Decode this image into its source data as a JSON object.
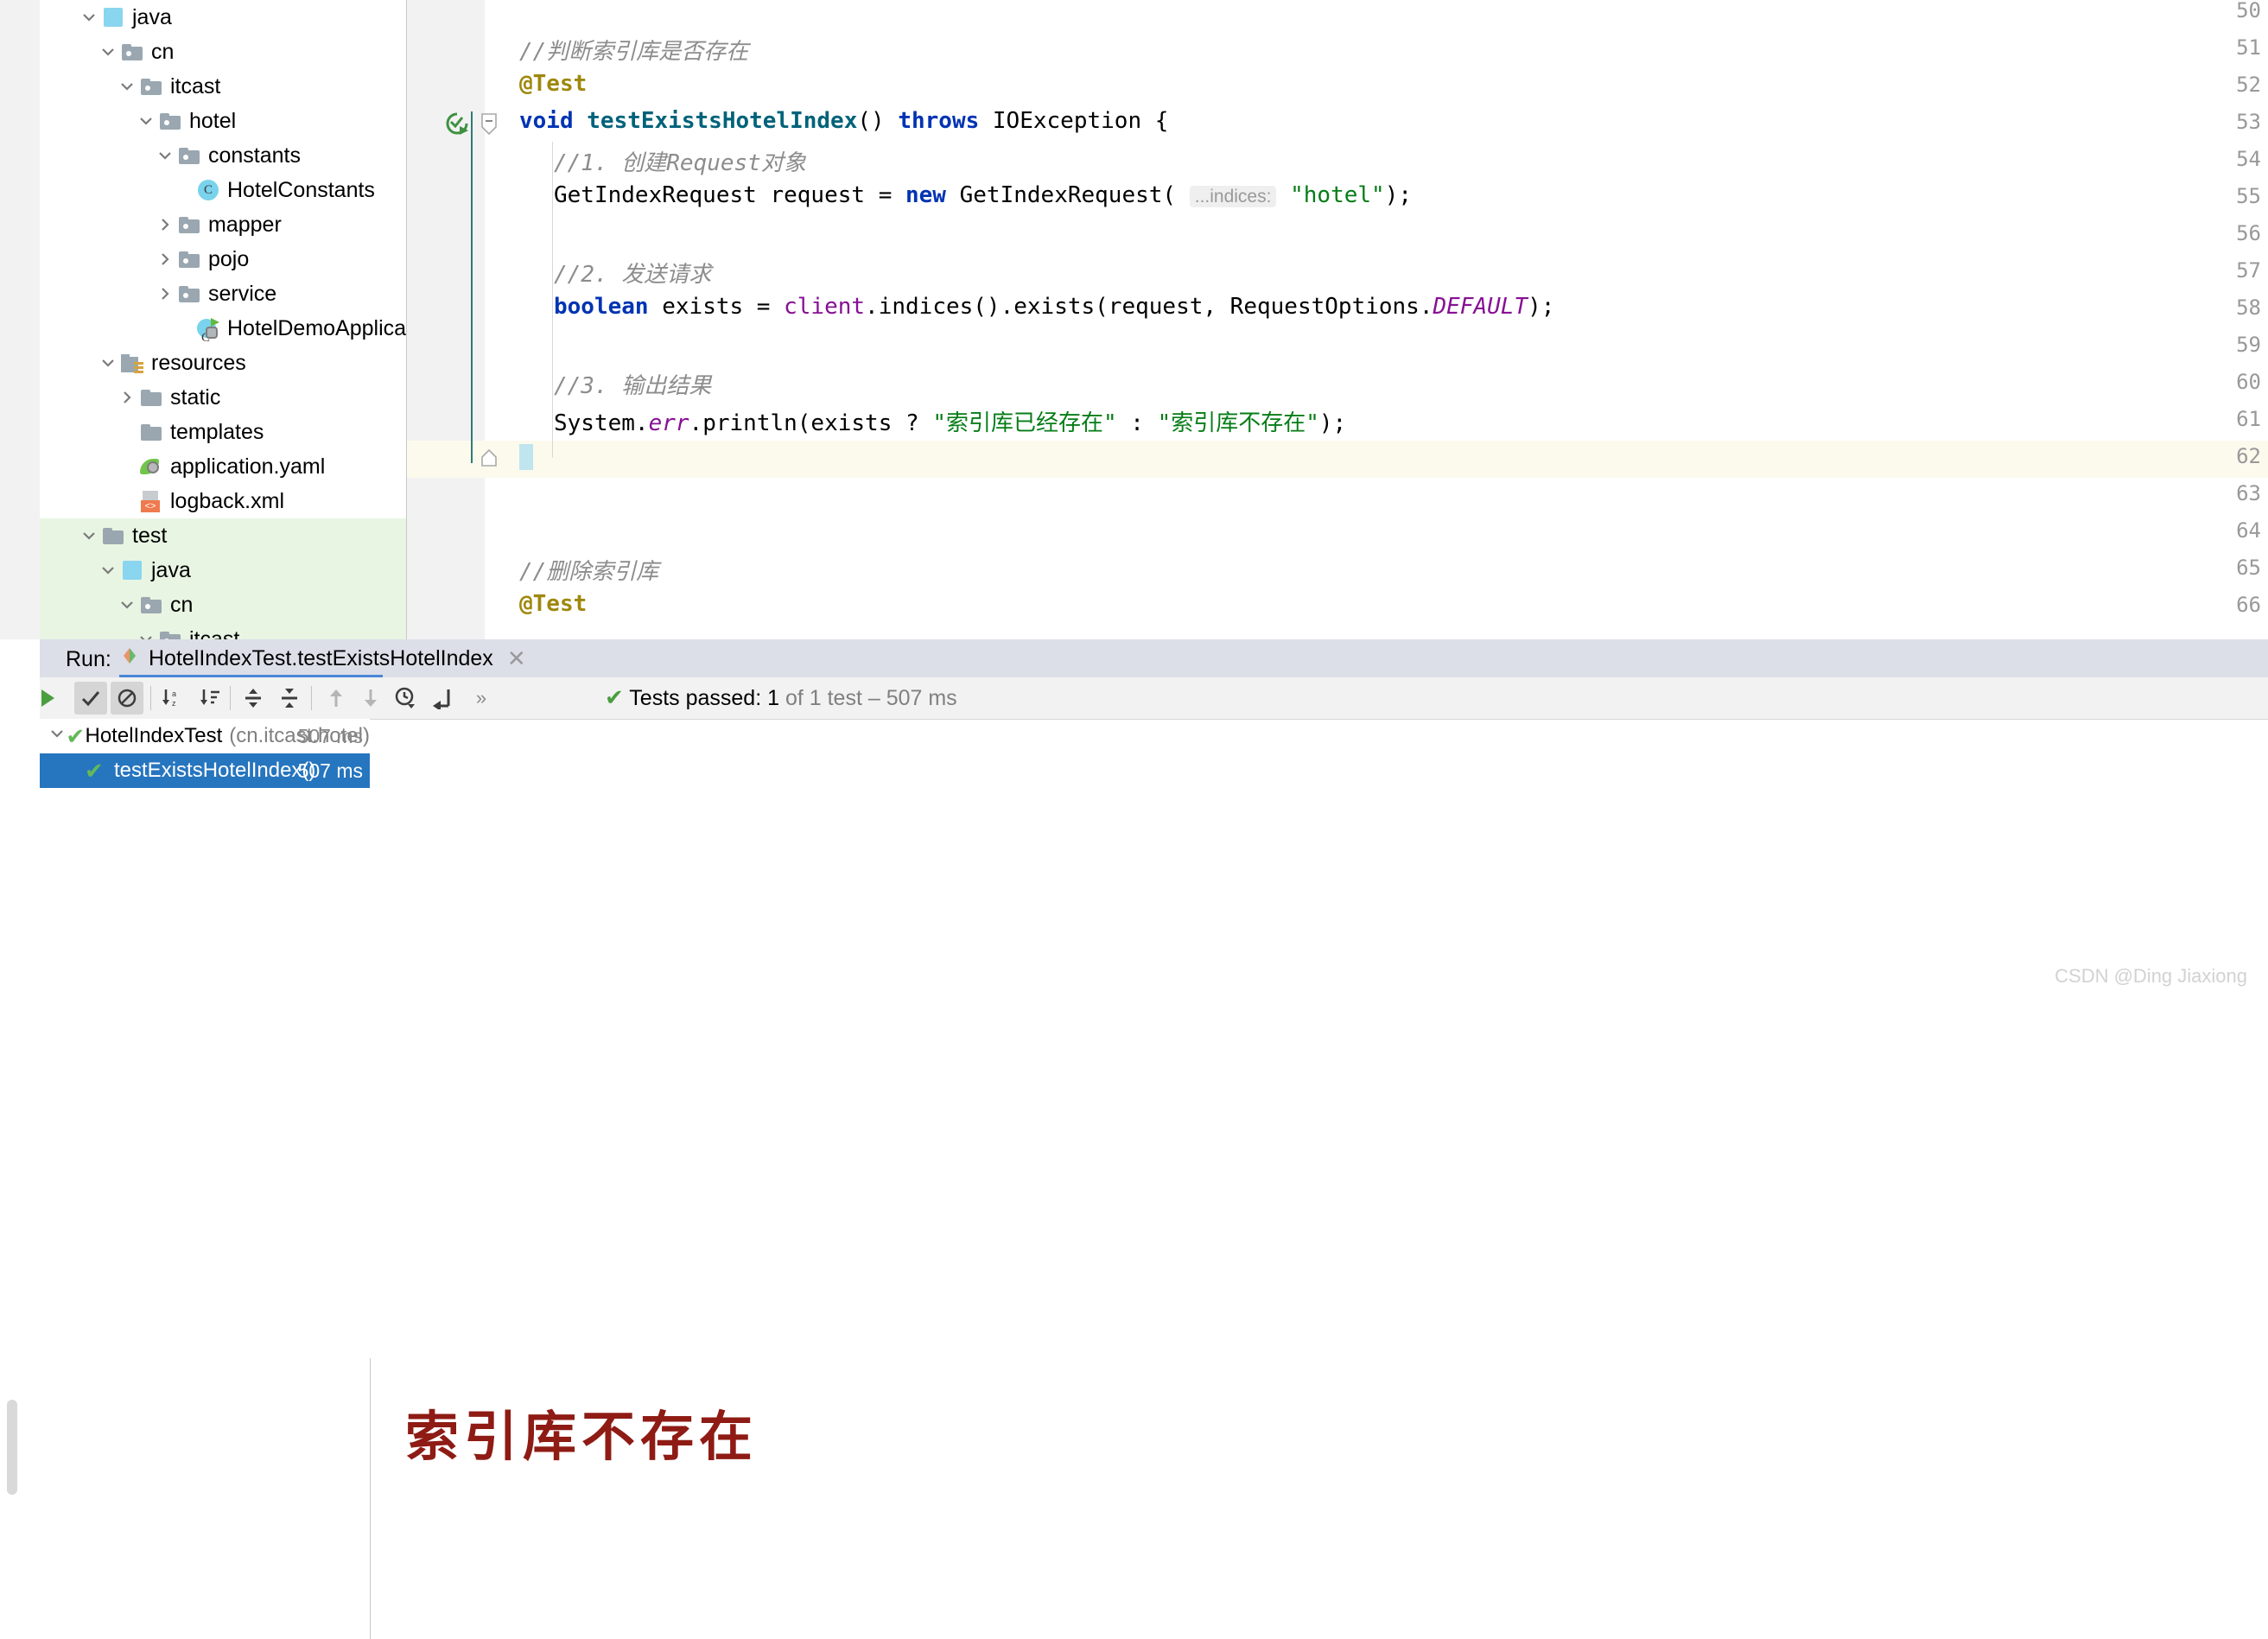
{
  "ide": {
    "project_tree": [
      {
        "label": "java",
        "type": "source-root",
        "indent": 2,
        "twisty": "down",
        "icon": "source-root-icon"
      },
      {
        "label": "cn",
        "type": "package",
        "indent": 3,
        "twisty": "down",
        "icon": "folder-icon"
      },
      {
        "label": "itcast",
        "type": "package",
        "indent": 4,
        "twisty": "down",
        "icon": "folder-icon"
      },
      {
        "label": "hotel",
        "type": "package",
        "indent": 5,
        "twisty": "down",
        "icon": "folder-icon"
      },
      {
        "label": "constants",
        "type": "package",
        "indent": 6,
        "twisty": "down",
        "icon": "folder-icon"
      },
      {
        "label": "HotelConstants",
        "type": "class",
        "indent": 7,
        "twisty": "none",
        "icon": "java-class-icon"
      },
      {
        "label": "mapper",
        "type": "package",
        "indent": 6,
        "twisty": "right",
        "icon": "folder-icon"
      },
      {
        "label": "pojo",
        "type": "package",
        "indent": 6,
        "twisty": "right",
        "icon": "folder-icon"
      },
      {
        "label": "service",
        "type": "package",
        "indent": 6,
        "twisty": "right",
        "icon": "folder-icon"
      },
      {
        "label": "HotelDemoApplication",
        "type": "spring-class",
        "indent": 7,
        "twisty": "none",
        "icon": "spring-boot-class-icon"
      },
      {
        "label": "resources",
        "type": "resource-root",
        "indent": 3,
        "twisty": "down",
        "icon": "resources-folder-icon"
      },
      {
        "label": "static",
        "type": "folder",
        "indent": 4,
        "twisty": "right",
        "icon": "folder-plain-icon"
      },
      {
        "label": "templates",
        "type": "folder",
        "indent": 4,
        "twisty": "none",
        "icon": "folder-plain-icon"
      },
      {
        "label": "application.yaml",
        "type": "yaml",
        "indent": 4,
        "twisty": "none",
        "icon": "spring-yaml-icon"
      },
      {
        "label": "logback.xml",
        "type": "xml",
        "indent": 4,
        "twisty": "none",
        "icon": "xml-file-icon"
      },
      {
        "label": "test",
        "type": "folder",
        "indent": 2,
        "twisty": "down",
        "icon": "folder-plain-icon",
        "highlight": true
      },
      {
        "label": "java",
        "type": "test-source-root",
        "indent": 3,
        "twisty": "down",
        "icon": "folder-test-icon",
        "highlight": true
      },
      {
        "label": "cn",
        "type": "package",
        "indent": 4,
        "twisty": "down",
        "icon": "folder-icon",
        "highlight": true
      },
      {
        "label": "itcast",
        "type": "package",
        "indent": 5,
        "twisty": "down",
        "icon": "folder-icon",
        "highlight": true
      }
    ],
    "editor": {
      "first_line_number": 50,
      "caret_line_number": 62,
      "gutter_run_icon_line": 53,
      "lines": [
        {
          "n": "50",
          "tokens": []
        },
        {
          "n": "51",
          "tokens": [
            {
              "t": "//判断索引库是否存在",
              "c": "cmt",
              "indent": 0
            }
          ]
        },
        {
          "n": "52",
          "tokens": [
            {
              "t": "@Test",
              "c": "anno",
              "indent": 0
            }
          ]
        },
        {
          "n": "53",
          "tokens": [
            {
              "t": "void",
              "c": "k",
              "indent": 0
            },
            {
              "t": " ",
              "c": "plain"
            },
            {
              "t": "testExistsHotelIndex",
              "c": "mname"
            },
            {
              "t": "() ",
              "c": "plain"
            },
            {
              "t": "throws",
              "c": "k"
            },
            {
              "t": " ",
              "c": "plain"
            },
            {
              "t": "IOException",
              "c": "plain"
            },
            {
              "t": " {",
              "c": "plain"
            }
          ]
        },
        {
          "n": "54",
          "tokens": [
            {
              "t": "//1. 创建Request对象",
              "c": "cmt",
              "indent": 1
            }
          ]
        },
        {
          "n": "55",
          "tokens": [
            {
              "t": "GetIndexRequest",
              "c": "plain",
              "indent": 1
            },
            {
              "t": " request = ",
              "c": "plain"
            },
            {
              "t": "new",
              "c": "k"
            },
            {
              "t": " GetIndexRequest( ",
              "c": "plain"
            },
            {
              "t": "...indices:",
              "c": "chip"
            },
            {
              "t": " ",
              "c": "plain"
            },
            {
              "t": "\"hotel\"",
              "c": "str"
            },
            {
              "t": ");",
              "c": "plain"
            }
          ]
        },
        {
          "n": "56",
          "tokens": []
        },
        {
          "n": "57",
          "tokens": [
            {
              "t": "//2. 发送请求",
              "c": "cmt",
              "indent": 1
            }
          ]
        },
        {
          "n": "58",
          "tokens": [
            {
              "t": "boolean",
              "c": "k",
              "indent": 1
            },
            {
              "t": " exists = ",
              "c": "plain"
            },
            {
              "t": "client",
              "c": "fld"
            },
            {
              "t": ".indices().exists(request, RequestOptions.",
              "c": "plain"
            },
            {
              "t": "DEFAULT",
              "c": "sfld"
            },
            {
              "t": ");",
              "c": "plain"
            }
          ]
        },
        {
          "n": "59",
          "tokens": []
        },
        {
          "n": "60",
          "tokens": [
            {
              "t": "//3. 输出结果",
              "c": "cmt",
              "indent": 1
            }
          ]
        },
        {
          "n": "61",
          "tokens": [
            {
              "t": "System",
              "c": "plain",
              "indent": 1
            },
            {
              "t": ".",
              "c": "plain"
            },
            {
              "t": "err",
              "c": "sfld"
            },
            {
              "t": ".println(exists ? ",
              "c": "plain"
            },
            {
              "t": "\"索引库已经存在\"",
              "c": "str"
            },
            {
              "t": " : ",
              "c": "plain"
            },
            {
              "t": "\"索引库不存在\"",
              "c": "str"
            },
            {
              "t": ");",
              "c": "plain"
            }
          ]
        },
        {
          "n": "62",
          "tokens": [
            {
              "t": "}",
              "c": "plain",
              "indent": 0
            }
          ]
        },
        {
          "n": "63",
          "tokens": []
        },
        {
          "n": "64",
          "tokens": []
        },
        {
          "n": "65",
          "tokens": [
            {
              "t": "//删除索引库",
              "c": "cmt",
              "indent": 0
            }
          ]
        },
        {
          "n": "66",
          "tokens": [
            {
              "t": "@Test",
              "c": "anno",
              "indent": 0
            }
          ]
        }
      ]
    },
    "run_window": {
      "run_label": "Run:",
      "tab_title": "HotelIndexTest.testExistsHotelIndex",
      "close_glyph": "✕",
      "toolbar": [
        {
          "name": "rerun-button",
          "glyph": "▶"
        },
        {
          "name": "show-passed-toggle",
          "glyph": "✔"
        },
        {
          "name": "show-ignored-toggle",
          "glyph": "⊘"
        },
        {
          "name": "sort-alphabetically-button",
          "glyph": "↓a\\nz"
        },
        {
          "name": "sort-by-duration-button",
          "glyph": "↓≡"
        },
        {
          "name": "expand-all-button",
          "glyph": "⇲"
        },
        {
          "name": "collapse-all-button",
          "glyph": "⇱"
        },
        {
          "name": "previous-failed-test-button",
          "glyph": "↑"
        },
        {
          "name": "next-failed-test-button",
          "glyph": "↓"
        },
        {
          "name": "test-history-button",
          "glyph": "⏱"
        },
        {
          "name": "scroll-to-source-button",
          "glyph": "↙"
        },
        {
          "name": "more-options-button",
          "glyph": "»"
        }
      ],
      "status": {
        "prefix": "Tests passed: ",
        "count": "1",
        "suffix": " of 1 test – 507 ms"
      },
      "test_tree": [
        {
          "name": "HotelIndexTest",
          "package": "(cn.itcast.hotel)",
          "duration": "507 ms",
          "state": "passed",
          "selected": false,
          "twisty": "down"
        },
        {
          "name": "testExistsHotelIndex()",
          "package": "",
          "duration": "507 ms",
          "state": "passed",
          "selected": true,
          "twisty": "none"
        }
      ],
      "console_output": "索引库不存在"
    },
    "watermark": "CSDN @Ding Jiaxiong"
  }
}
